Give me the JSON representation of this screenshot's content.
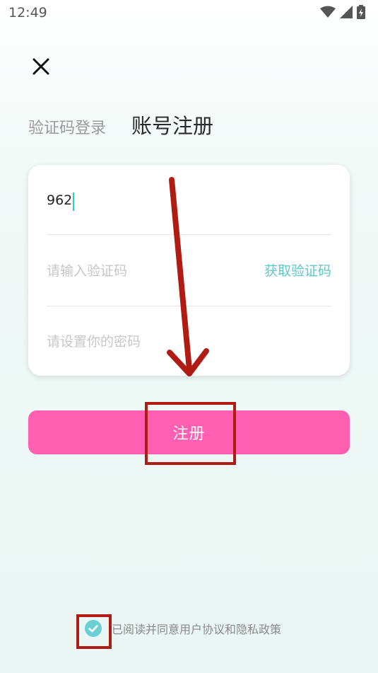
{
  "status_bar": {
    "time": "12:49"
  },
  "tabs": {
    "login_sms": "验证码登录",
    "register": "账号注册"
  },
  "form": {
    "phone_value": "962",
    "code_placeholder": "请输入验证码",
    "get_code_label": "获取验证码",
    "password_placeholder": "请设置你的密码"
  },
  "register_button": {
    "label": "注册"
  },
  "agreement": {
    "text": "已阅读并同意用户协议和隐私政策",
    "checked": true
  },
  "colors": {
    "accent_pink": "#ff5fb1",
    "teal": "#5ec8c8",
    "annotation_red": "#b01c14"
  },
  "icons": [
    "wifi-icon",
    "signal-icon",
    "battery-icon",
    "close-icon",
    "check-icon",
    "down-arrow-annotation"
  ]
}
